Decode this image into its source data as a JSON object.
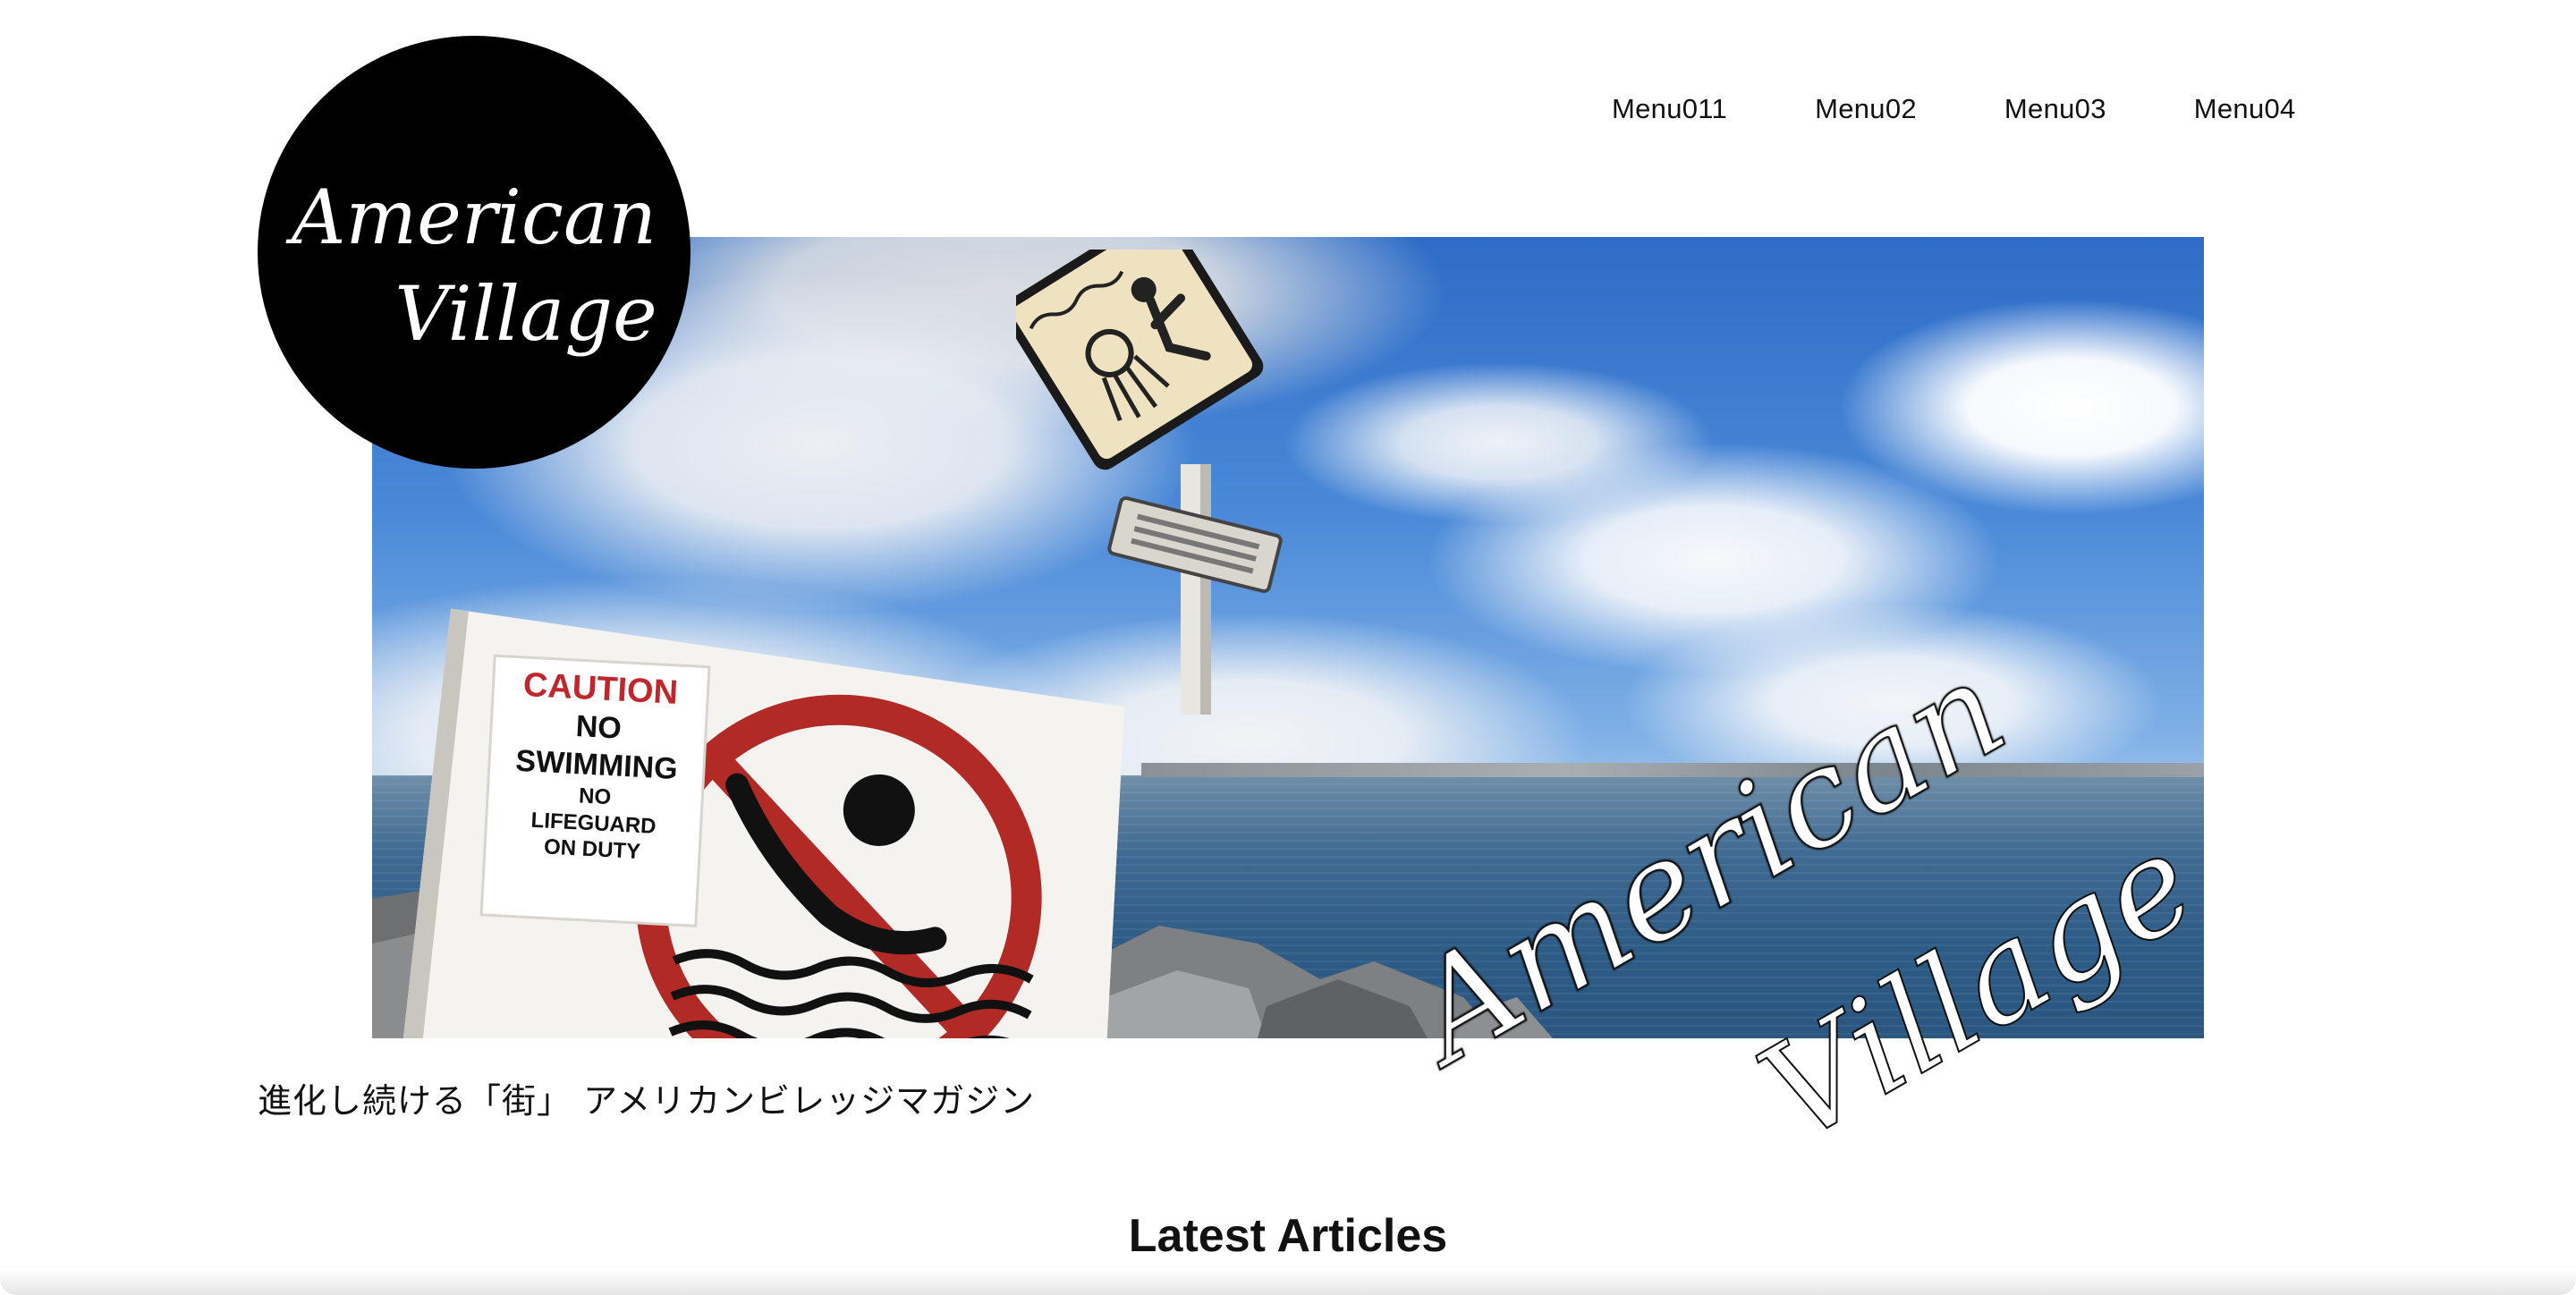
{
  "nav": {
    "items": [
      {
        "label": "Menu011"
      },
      {
        "label": "Menu02"
      },
      {
        "label": "Menu03"
      },
      {
        "label": "Menu04"
      }
    ]
  },
  "logo": {
    "text_line1": "American",
    "text_line2": "Village"
  },
  "hero": {
    "sign": {
      "line1": "CAUTION",
      "line2": "NO",
      "line3": "SWIMMING",
      "line4": "NO",
      "line5": "LIFEGUARD",
      "line6": "ON DUTY"
    },
    "script_line1": "American",
    "script_line2": "Village"
  },
  "tagline": "進化し続ける「街」 アメリカンビレッジマガジン",
  "latest_heading": "Latest Articles",
  "colors": {
    "background": "#ffffff",
    "text": "#111111",
    "logo_bg": "#000000",
    "caution_red": "#c0262b"
  }
}
